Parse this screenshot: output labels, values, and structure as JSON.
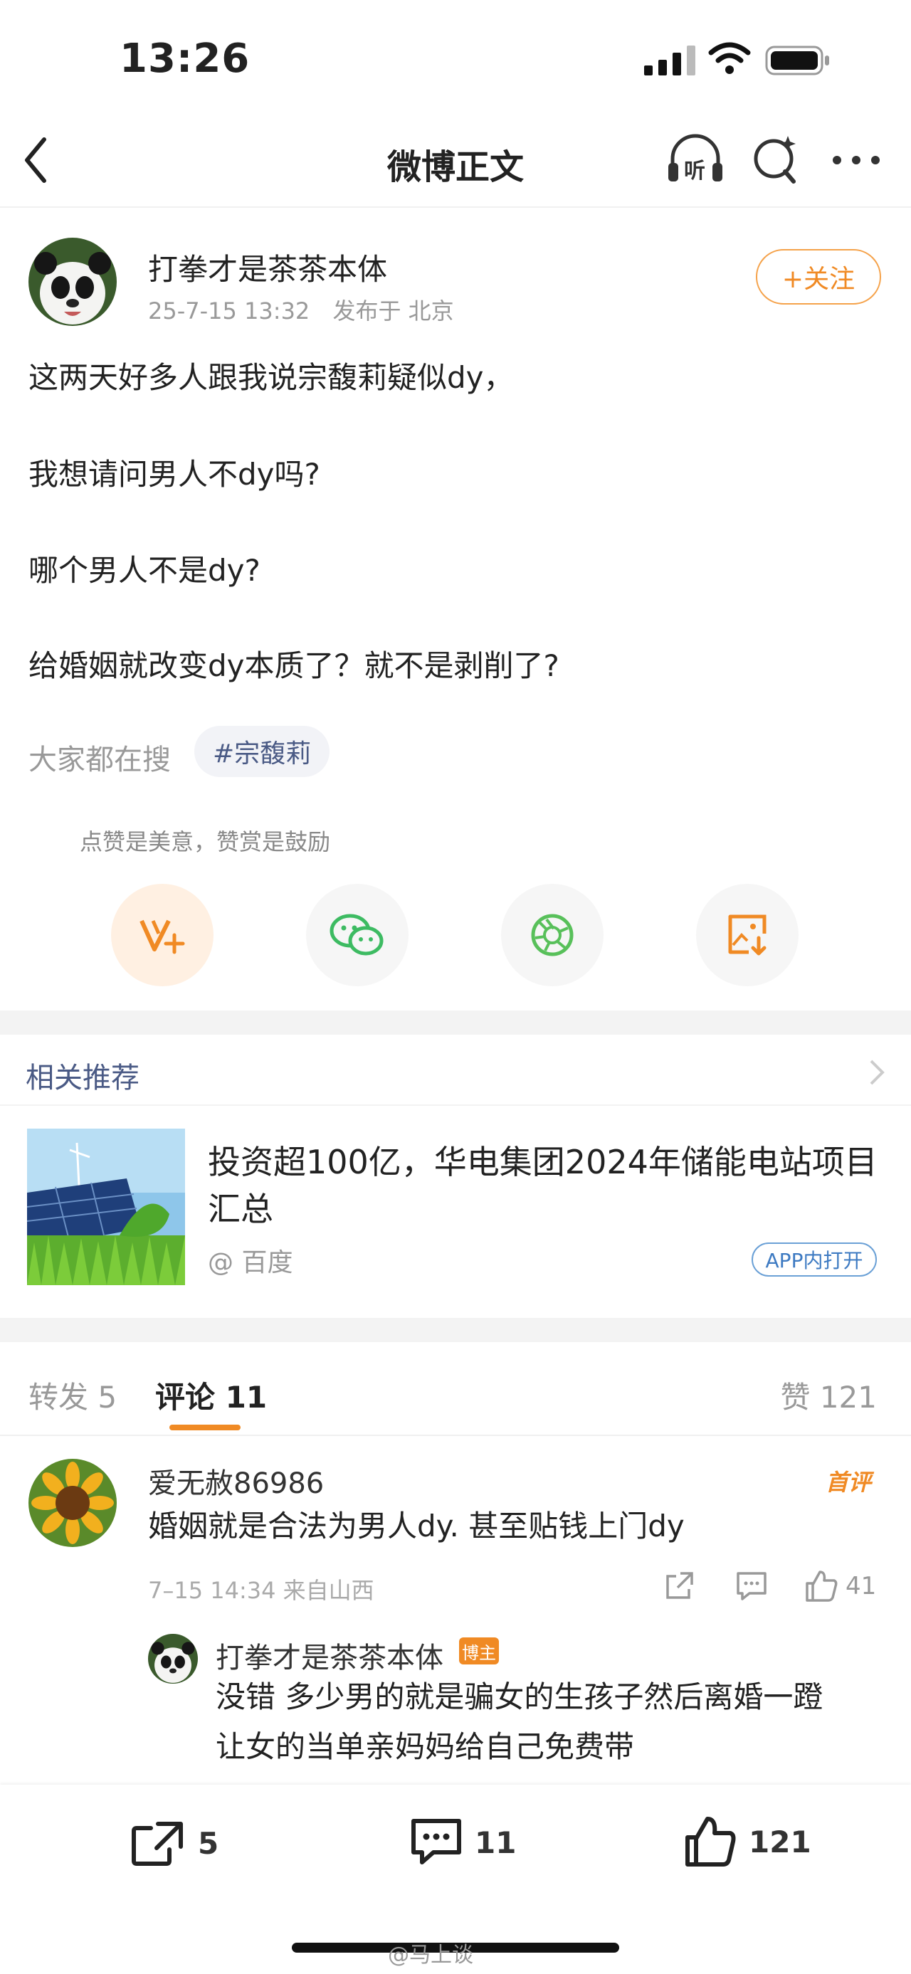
{
  "status_bar": {
    "time": "13:26"
  },
  "nav": {
    "title": "微博正文",
    "listen_label": "听"
  },
  "post": {
    "author": "打拳才是茶茶本体",
    "time": "25-7-15 13:32",
    "location": "发布于 北京",
    "follow_label": "+关注",
    "lines": [
      "这两天好多人跟我说宗馥莉疑似dy，",
      "我想请问男人不dy吗?",
      "哪个男人不是dy?",
      "给婚姻就改变dy本质了？就不是剥削了?"
    ],
    "hot_search_label": "大家都在搜",
    "hot_tag": "#宗馥莉",
    "tip": "点赞是美意，赞赏是鼓励"
  },
  "share_icons": [
    "reward-icon",
    "wechat-icon",
    "moments-icon",
    "save-image-icon"
  ],
  "recommend": {
    "title": "相关推荐",
    "headline": "投资超100亿，华电集团2024年储能电站项目汇总",
    "source": "@ 百度",
    "app_open": "APP内打开"
  },
  "tabs": {
    "repost": "转发 5",
    "comment": "评论 11",
    "like": "赞 121"
  },
  "comments": [
    {
      "name": "爱无赦86986",
      "badge": "首评",
      "text": "婚姻就是合法为男人dy. 甚至贴钱上门dy",
      "meta": "7–15 14:34  来自山西",
      "likes": "41"
    }
  ],
  "reply": {
    "name": "打拳才是茶茶本体",
    "badge": "博主",
    "text_line1": "没错 多少男的就是骗女的生孩子然后离婚一蹬",
    "text_line2": "让女的当单亲妈妈给自己免费带"
  },
  "bottom_bar": {
    "repost": "5",
    "comment": "11",
    "like": "121"
  },
  "watermark": "@马上谈",
  "colors": {
    "accent": "#f08a24",
    "link": "#4a5a85",
    "wechat": "#3dbb62",
    "moments": "#58c05a"
  }
}
